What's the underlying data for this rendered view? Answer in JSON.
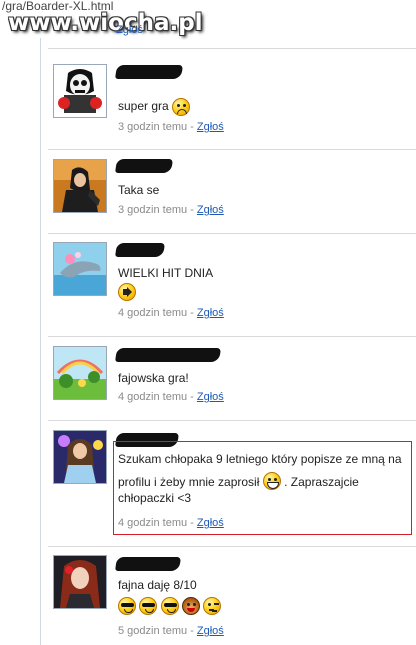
{
  "browser": {
    "url_fragment": "/gra/Boarder-XL.html"
  },
  "watermark": "www.wiocha.pl",
  "top_meta": {
    "report_label": "Zgłoś"
  },
  "comments": [
    {
      "text": "super gra",
      "emoticons": [
        "sad-smiley-icon"
      ],
      "time": "3 godzin temu",
      "separator": "-",
      "report_label": "Zgłoś"
    },
    {
      "text": "Taka se",
      "emoticons": [],
      "time": "3 godzin temu",
      "separator": "-",
      "report_label": "Zgłoś"
    },
    {
      "text": "WIELKI HIT DNIA",
      "emoticons": [
        "speaker-smiley-icon"
      ],
      "time": "4 godzin temu",
      "separator": "-",
      "report_label": "Zgłoś"
    },
    {
      "text": "fajowska gra!",
      "emoticons": [],
      "time": "4 godzin temu",
      "separator": "-",
      "report_label": "Zgłoś"
    },
    {
      "text_line1": "Szukam chłopaka 9 letniego który popisze ze mną na",
      "text_line2a": "profilu i żeby mnie zaprosił",
      "text_line2b": ". Zapraszajcie",
      "text_line3": "chłopaczki <3",
      "emoticons": [
        "grin-smiley-icon"
      ],
      "time": "4 godzin temu",
      "separator": "-",
      "report_label": "Zgłoś",
      "highlight_color": "#d21f2a"
    },
    {
      "text": "fajna daję 8/10",
      "emoticons": [
        "sunglasses-smiley-icon",
        "sunglasses-smiley-icon",
        "sunglasses-smiley-icon",
        "monkey-smiley-icon",
        "wink-smiley-icon"
      ],
      "time": "5 godzin temu",
      "separator": "-",
      "report_label": "Zgłoś"
    }
  ],
  "colors": {
    "link": "#1e5ab4",
    "meta": "#8a8a8a",
    "separator": "#d9d9d9",
    "highlight": "#d21f2a"
  }
}
